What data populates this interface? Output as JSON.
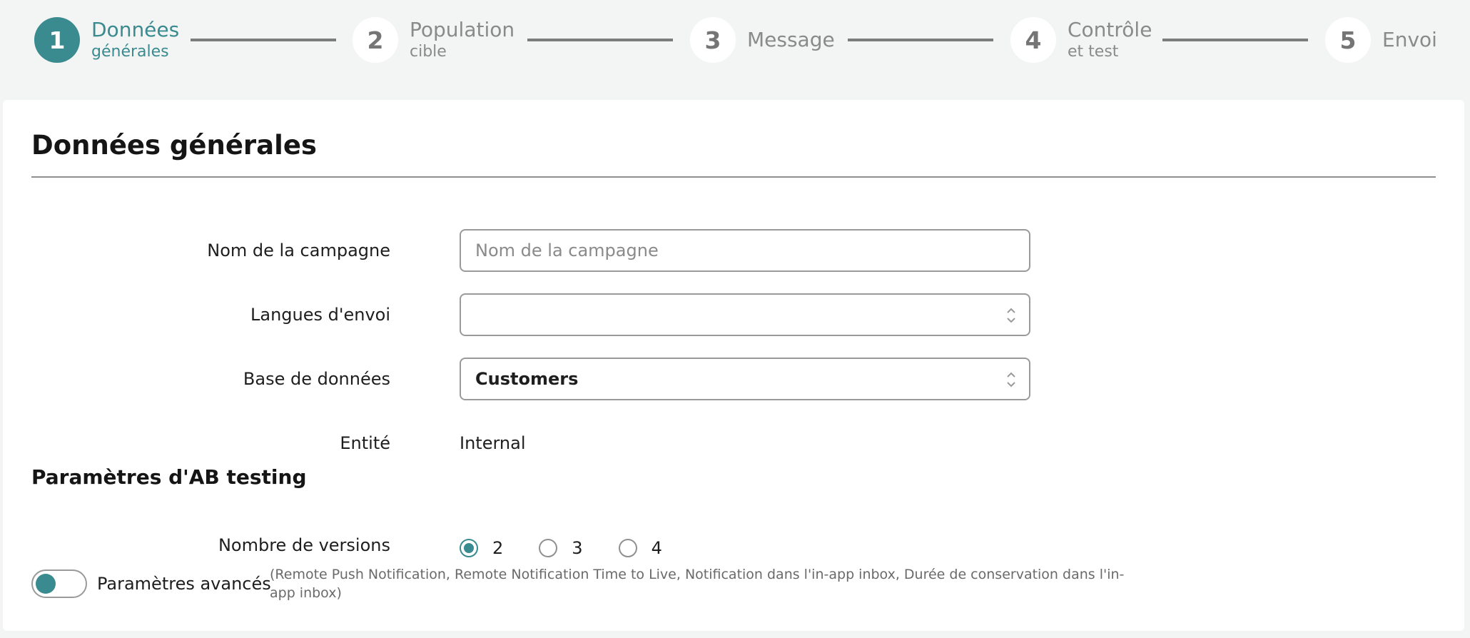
{
  "stepper": {
    "steps": [
      {
        "number": "1",
        "title": "Données",
        "subtitle": "générales"
      },
      {
        "number": "2",
        "title": "Population",
        "subtitle": "cible"
      },
      {
        "number": "3",
        "title": "Message",
        "subtitle": ""
      },
      {
        "number": "4",
        "title": "Contrôle",
        "subtitle": "et test"
      },
      {
        "number": "5",
        "title": "Envoi",
        "subtitle": ""
      }
    ],
    "active_step": 1
  },
  "form": {
    "title": "Données générales",
    "campaign_name": {
      "label": "Nom de la campagne",
      "value": "",
      "placeholder": "Nom de la campagne"
    },
    "languages": {
      "label": "Langues d'envoi",
      "value": ""
    },
    "database": {
      "label": "Base de données",
      "value": "Customers"
    },
    "entity": {
      "label": "Entité",
      "value": "Internal"
    }
  },
  "ab_testing": {
    "title": "Paramètres d'AB testing",
    "versions": {
      "label": "Nombre de versions",
      "options": [
        "2",
        "3",
        "4"
      ],
      "selected": "2"
    },
    "advanced": {
      "label": "Paramètres avancés",
      "description": "(Remote Push Notification, Remote Notification Time to Live, Notification dans l'in-app inbox, Durée de conservation dans l'in-app inbox)",
      "enabled": false
    }
  },
  "colors": {
    "accent": "#3a8b8f",
    "page_background": "#f3f5f4",
    "inactive_step": "#8a8a8a"
  }
}
